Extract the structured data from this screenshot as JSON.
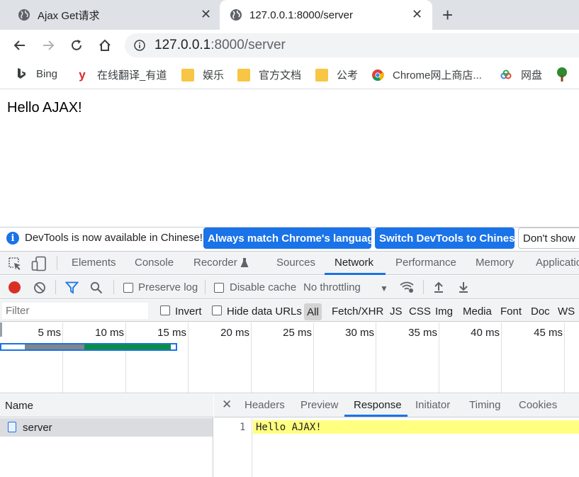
{
  "browser": {
    "tabs": [
      {
        "title": "Ajax Get请求",
        "icon": "globe-icon",
        "active": false
      },
      {
        "title": "127.0.0.1:8000/server",
        "icon": "globe-icon",
        "active": true
      }
    ],
    "address": {
      "host": "127.0.0.1",
      "rest": ":8000/server"
    },
    "bookmarks": [
      {
        "label": "Bing",
        "icon": "bing-icon"
      },
      {
        "label": "在线翻译_有道",
        "icon": "youdao-icon"
      },
      {
        "label": "娱乐",
        "icon": "folder-icon"
      },
      {
        "label": "官方文档",
        "icon": "folder-icon"
      },
      {
        "label": "公考",
        "icon": "folder-icon"
      },
      {
        "label": "Chrome网上商店...",
        "icon": "chrome-icon"
      },
      {
        "label": "网盘",
        "icon": "cloud-icon"
      }
    ]
  },
  "page": {
    "body_text": "Hello AJAX!"
  },
  "devtools": {
    "infobar": {
      "message": "DevTools is now available in Chinese!",
      "btn_match": "Always match Chrome's language",
      "btn_switch": "Switch DevTools to Chinese",
      "btn_dont": "Don't show"
    },
    "tabs": [
      "Elements",
      "Console",
      "Recorder",
      "Sources",
      "Network",
      "Performance",
      "Memory",
      "Application"
    ],
    "selected_tab": "Network",
    "toolbar": {
      "preserve_log": "Preserve log",
      "disable_cache": "Disable cache",
      "throttling": "No throttling"
    },
    "filter": {
      "placeholder": "Filter",
      "invert": "Invert",
      "hide_data_urls": "Hide data URLs",
      "types": [
        "All",
        "Fetch/XHR",
        "JS",
        "CSS",
        "Img",
        "Media",
        "Font",
        "Doc",
        "WS"
      ]
    },
    "timeline_ticks": [
      "5 ms",
      "10 ms",
      "15 ms",
      "20 ms",
      "25 ms",
      "30 ms",
      "35 ms",
      "40 ms",
      "45 ms"
    ],
    "requests": {
      "header": "Name",
      "rows": [
        {
          "name": "server"
        }
      ]
    },
    "detail": {
      "tabs": [
        "Headers",
        "Preview",
        "Response",
        "Initiator",
        "Timing",
        "Cookies"
      ],
      "selected": "Response",
      "response_lines": [
        {
          "no": "1",
          "text": "Hello AJAX!"
        }
      ]
    }
  }
}
